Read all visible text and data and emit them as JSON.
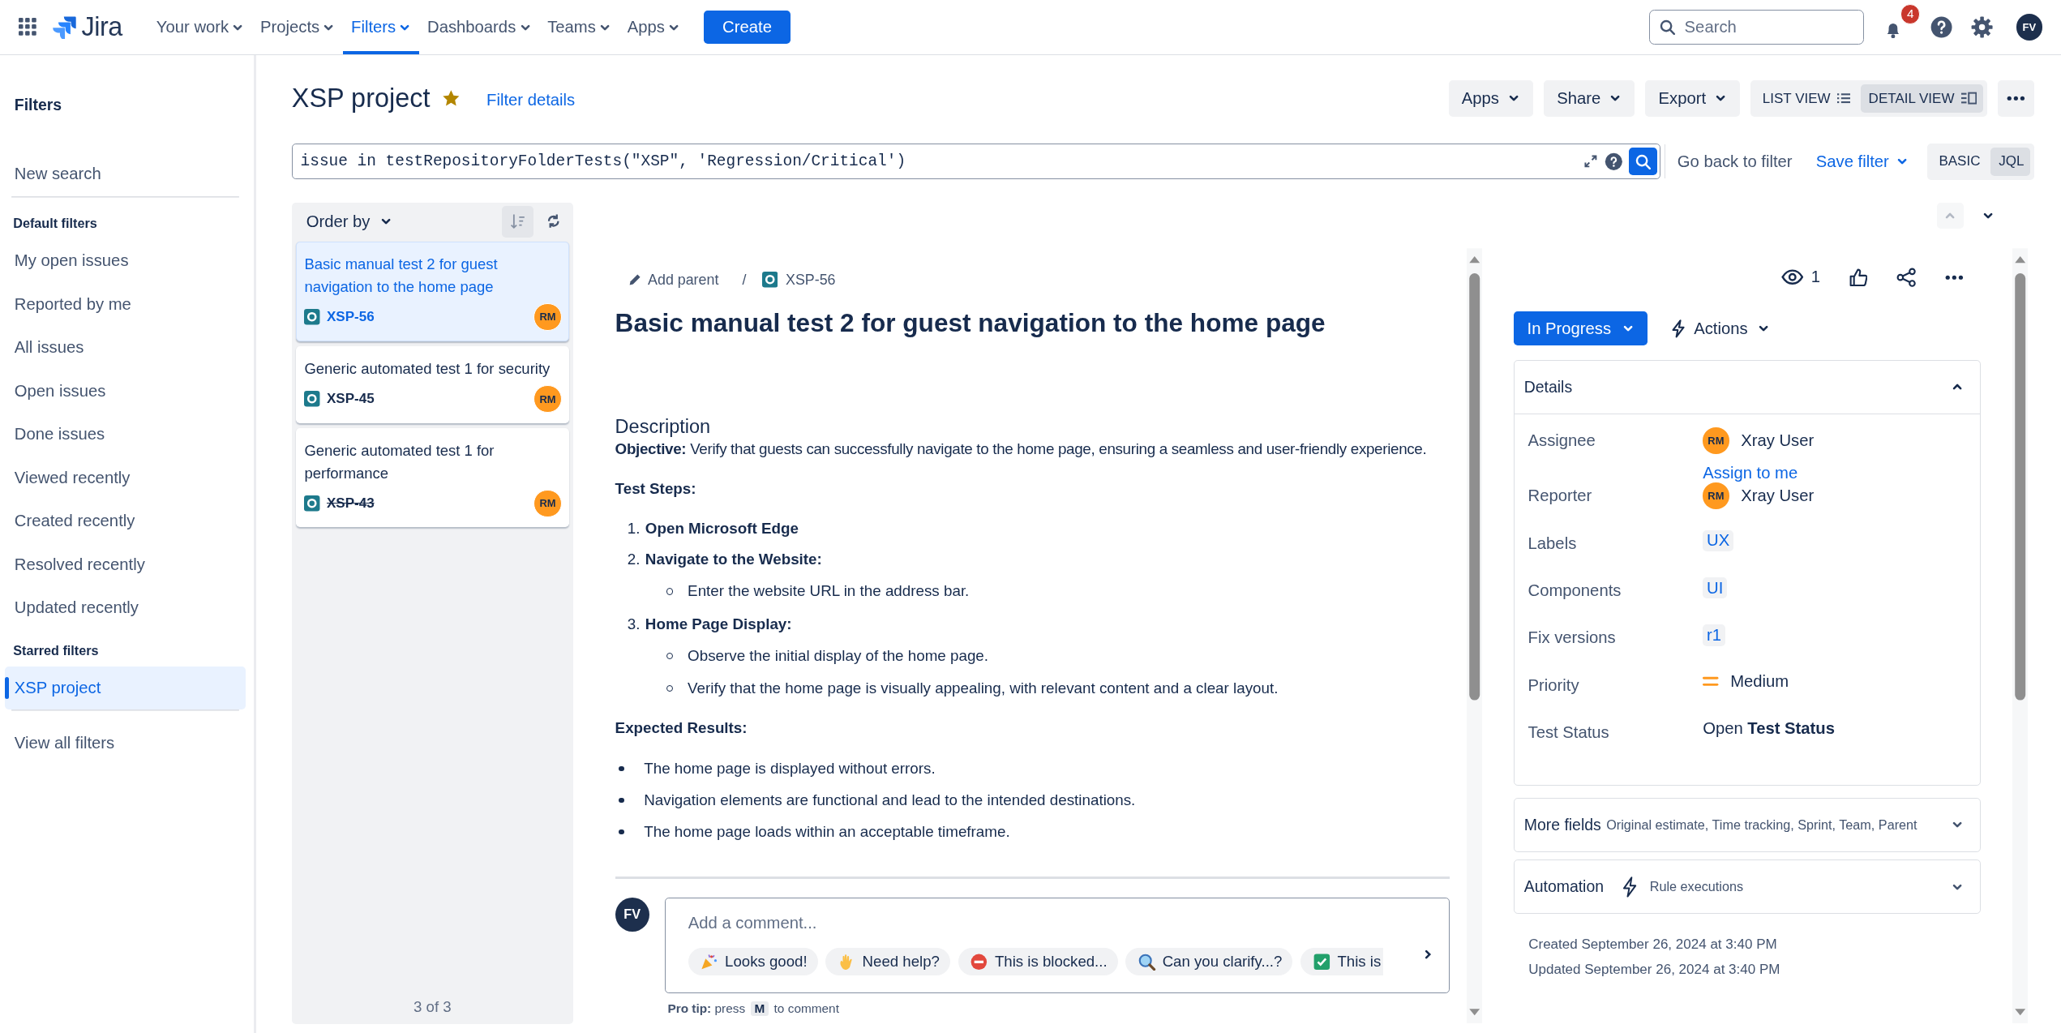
{
  "nav": {
    "logo": "Jira",
    "items": [
      {
        "label": "Your work",
        "selected": false
      },
      {
        "label": "Projects",
        "selected": false
      },
      {
        "label": "Filters",
        "selected": true
      },
      {
        "label": "Dashboards",
        "selected": false
      },
      {
        "label": "Teams",
        "selected": false
      },
      {
        "label": "Apps",
        "selected": false
      }
    ],
    "create": "Create",
    "search_placeholder": "Search",
    "notification_count": "4",
    "avatar": "FV"
  },
  "sidebar": {
    "title": "Filters",
    "groups": [
      {
        "divider_after": true,
        "items": [
          {
            "label": "New search",
            "selected": false
          }
        ]
      },
      {
        "heading": "Default filters",
        "divider_after": false,
        "items": [
          {
            "label": "My open issues",
            "selected": false
          },
          {
            "label": "Reported by me",
            "selected": false
          },
          {
            "label": "All issues",
            "selected": false
          },
          {
            "label": "Open issues",
            "selected": false
          },
          {
            "label": "Done issues",
            "selected": false
          },
          {
            "label": "Viewed recently",
            "selected": false
          },
          {
            "label": "Created recently",
            "selected": false
          },
          {
            "label": "Resolved recently",
            "selected": false
          },
          {
            "label": "Updated recently",
            "selected": false
          }
        ]
      },
      {
        "heading": "Starred filters",
        "divider_after": true,
        "items": [
          {
            "label": "XSP project",
            "selected": true
          }
        ]
      },
      {
        "divider_after": false,
        "items": [
          {
            "label": "View all filters",
            "selected": false
          }
        ]
      }
    ]
  },
  "header": {
    "title": "XSP project",
    "starred": true,
    "filter_details": "Filter details",
    "menus": [
      "Apps",
      "Share",
      "Export"
    ],
    "views": [
      {
        "label": "LIST VIEW",
        "kind": "list",
        "selected": false
      },
      {
        "label": "DETAIL VIEW",
        "kind": "detail",
        "selected": true
      }
    ]
  },
  "jql": {
    "query": "issue in testRepositoryFolderTests(\"XSP\", 'Regression/Critical')",
    "go_back": "Go back to filter",
    "save_filter": "Save filter",
    "modes": [
      {
        "label": "BASIC",
        "selected": false
      },
      {
        "label": "JQL",
        "selected": true
      }
    ]
  },
  "issue_list": {
    "order_by": "Order by",
    "count": "3 of 3",
    "issues": [
      {
        "title": "Basic manual test 2 for guest navigation to the home page",
        "key": "XSP-56",
        "assignee": "RM",
        "selected": true,
        "resolved": false
      },
      {
        "title": "Generic automated test 1 for security",
        "key": "XSP-45",
        "assignee": "RM",
        "selected": false,
        "resolved": false
      },
      {
        "title": "Generic automated test 1 for performance",
        "key": "XSP-43",
        "assignee": "RM",
        "selected": false,
        "resolved": true
      }
    ]
  },
  "issue": {
    "add_parent": "Add parent",
    "breadcrumb_separator": "/",
    "key": "XSP-56",
    "title": "Basic manual test 2 for guest navigation to the home page",
    "watchers": "1",
    "status": "In Progress",
    "actions": "Actions",
    "description": [
      {
        "kind": "heading",
        "text": "Description"
      },
      {
        "kind": "paragraph",
        "text": "**Objective:** Verify that guests can successfully navigate to the home page, ensuring a seamless and user-friendly experience."
      },
      {
        "kind": "subheading",
        "text": "Test Steps:"
      },
      {
        "kind": "ordered",
        "items": [
          {
            "number": "1.",
            "text": "Open Microsoft Edge"
          },
          {
            "number": "2.",
            "text": "Navigate to the Website:",
            "children": [
              {
                "text": "Enter the website URL in the address bar."
              }
            ]
          },
          {
            "number": "3.",
            "text": "Home Page Display:",
            "children": [
              {
                "text": "Observe the initial display of the home page."
              },
              {
                "text": "Verify that the home page is visually appealing, with relevant content and a clear layout."
              }
            ]
          }
        ]
      },
      {
        "kind": "subheading",
        "text": "Expected Results:"
      },
      {
        "kind": "bulleted",
        "items": [
          {
            "text": "The home page is displayed without errors."
          },
          {
            "text": "Navigation elements are functional and lead to the intended destinations."
          },
          {
            "text": "The home page loads within an acceptable timeframe."
          }
        ]
      }
    ],
    "comment": {
      "avatar": "FV",
      "placeholder": "Add a comment...",
      "suggestions": [
        {
          "kind": "party",
          "label": "Looks good!"
        },
        {
          "kind": "wave",
          "label": "Need help?"
        },
        {
          "kind": "stop",
          "label": "This is blocked..."
        },
        {
          "kind": "magnifier",
          "label": "Can you clarify...?"
        },
        {
          "kind": "check",
          "label": "This is"
        }
      ],
      "tip_label": "Pro tip:",
      "tip_press": "press",
      "tip_key": "M",
      "tip_after": "to comment"
    }
  },
  "details": {
    "title": "Details",
    "expanded": true,
    "fields": [
      {
        "kind": "user",
        "label": "Assignee",
        "avatar": "RM",
        "value": "Xray User",
        "link": "Assign to me"
      },
      {
        "kind": "user",
        "label": "Reporter",
        "avatar": "RM",
        "value": "Xray User"
      },
      {
        "kind": "tag",
        "label": "Labels",
        "value": "UX"
      },
      {
        "kind": "tag",
        "label": "Components",
        "value": "UI"
      },
      {
        "kind": "tag",
        "label": "Fix versions",
        "value": "r1"
      },
      {
        "kind": "priority",
        "label": "Priority",
        "value": "Medium"
      },
      {
        "kind": "text",
        "label": "Test Status",
        "value": "Open **Test Status**"
      }
    ]
  },
  "more_fields": {
    "title": "More fields",
    "summary": "Original estimate, Time tracking, Sprint, Team, Parent",
    "expanded": false
  },
  "automation": {
    "title": "Automation",
    "summary": "Rule executions",
    "expanded": false
  },
  "created": "Created September 26, 2024 at 3:40 PM",
  "updated": "Updated September 26, 2024 at 3:40 PM"
}
